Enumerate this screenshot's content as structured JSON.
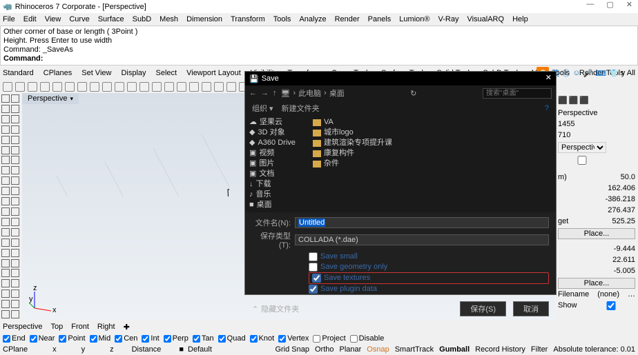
{
  "title": "Rhinoceros 7 Corporate - [Perspective]",
  "winbtns": {
    "min": "—",
    "max": "▢",
    "close": "✕"
  },
  "menu": [
    "File",
    "Edit",
    "View",
    "Curve",
    "Surface",
    "SubD",
    "Mesh",
    "Dimension",
    "Transform",
    "Tools",
    "Analyze",
    "Render",
    "Panels",
    "Lumion®",
    "V-Ray",
    "VisualARQ",
    "Help"
  ],
  "cmd": {
    "l1": "Other corner of base or length ( 3Point )",
    "l2": "Height. Press Enter to use width",
    "l3": "Command: _SaveAs",
    "l4": "Command:"
  },
  "tabs": [
    "Standard",
    "CPlanes",
    "Set View",
    "Display",
    "Select",
    "Viewport Layout",
    "Visibility",
    "Transform",
    "Curve Tools",
    "Surface Tools",
    "Solid Tools",
    "SubD Tools",
    "Mesh Tools",
    "Render Tools"
  ],
  "tabExtra": "y  All",
  "viewport": {
    "name": "Perspective",
    "arrow": "▾"
  },
  "prop": {
    "view": "Perspective",
    "num1": "1455",
    "num2": "710",
    "proj": "Perspective",
    "m": "m)",
    "v1": "50.0",
    "v2": "162.406",
    "v3": "-386.218",
    "v4": "276.437",
    "get": "get",
    "v5": "525.25",
    "place": "Place...",
    "v6": "-9.444",
    "v7": "22.611",
    "v8": "-5.005",
    "filename": "Filename",
    "fvalue": "(none)",
    "show": "Show"
  },
  "bottomTabs": [
    "Perspective",
    "Top",
    "Front",
    "Right"
  ],
  "snap": {
    "items": [
      "End",
      "Near",
      "Point",
      "Mid",
      "Cen",
      "Int",
      "Perp",
      "Tan",
      "Quad",
      "Knot",
      "Vertex",
      "Project",
      "Disable"
    ],
    "checked": [
      true,
      true,
      true,
      true,
      true,
      true,
      true,
      true,
      true,
      true,
      true,
      false,
      false
    ]
  },
  "status": {
    "cplane": "CPlane",
    "x": "x",
    "y": "y",
    "z": "z",
    "distance": "Distance",
    "default": "Default",
    "items": [
      "Grid Snap",
      "Ortho",
      "Planar",
      "Osnap",
      "SmartTrack",
      "Gumball",
      "Record History",
      "Filter",
      "Absolute tolerance: 0.01"
    ]
  },
  "dlg": {
    "title": "Save",
    "nav": {
      "back": "←",
      "fwd": "→",
      "up": "↑",
      "pc": "此电脑",
      "sep": "›",
      "desk": "桌面",
      "refresh": "↻",
      "searchPh": "搜索\"桌面\""
    },
    "bar": {
      "org": "组织 ▾",
      "newf": "新建文件夹",
      "help": "?"
    },
    "tree": [
      {
        "ico": "☁",
        "label": "坚果云"
      },
      {
        "ico": "◆",
        "label": "3D 对象"
      },
      {
        "ico": "◆",
        "label": "A360 Drive"
      },
      {
        "ico": "▣",
        "label": "视频"
      },
      {
        "ico": "▣",
        "label": "图片"
      },
      {
        "ico": "▣",
        "label": "文档"
      },
      {
        "ico": "↓",
        "label": "下载"
      },
      {
        "ico": "♪",
        "label": "音乐"
      },
      {
        "ico": "■",
        "label": "桌面"
      }
    ],
    "files": [
      "VA",
      "城市logo",
      "建筑渲染专项提升课",
      "康复构件",
      "杂件"
    ],
    "filenameLabel": "文件名(N):",
    "filenameValue": "Untitled",
    "typeLabel": "保存类型(T):",
    "typeValue": "COLLADA (*.dae)",
    "opts": [
      {
        "label": "Save small",
        "checked": false
      },
      {
        "label": "Save geometry only",
        "checked": false
      },
      {
        "label": "Save textures",
        "checked": true,
        "highlight": true
      },
      {
        "label": "Save plugin data",
        "checked": true
      }
    ],
    "hide": "隐藏文件夹",
    "save": "保存(S)",
    "cancel": "取消"
  }
}
